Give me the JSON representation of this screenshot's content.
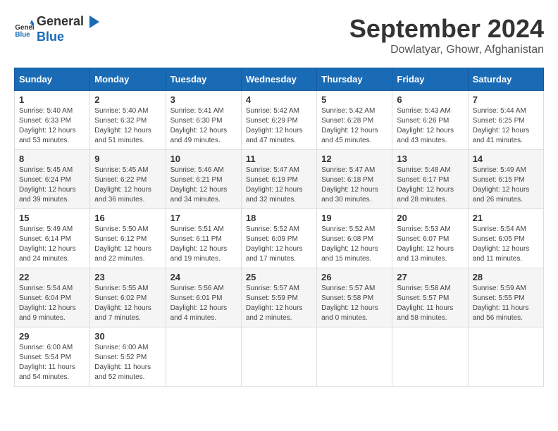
{
  "header": {
    "logo_general": "General",
    "logo_blue": "Blue",
    "month_year": "September 2024",
    "location": "Dowlatyar, Ghowr, Afghanistan"
  },
  "columns": [
    "Sunday",
    "Monday",
    "Tuesday",
    "Wednesday",
    "Thursday",
    "Friday",
    "Saturday"
  ],
  "weeks": [
    [
      {
        "day": "1",
        "sunrise": "5:40 AM",
        "sunset": "6:33 PM",
        "daylight": "12 hours and 53 minutes."
      },
      {
        "day": "2",
        "sunrise": "5:40 AM",
        "sunset": "6:32 PM",
        "daylight": "12 hours and 51 minutes."
      },
      {
        "day": "3",
        "sunrise": "5:41 AM",
        "sunset": "6:30 PM",
        "daylight": "12 hours and 49 minutes."
      },
      {
        "day": "4",
        "sunrise": "5:42 AM",
        "sunset": "6:29 PM",
        "daylight": "12 hours and 47 minutes."
      },
      {
        "day": "5",
        "sunrise": "5:42 AM",
        "sunset": "6:28 PM",
        "daylight": "12 hours and 45 minutes."
      },
      {
        "day": "6",
        "sunrise": "5:43 AM",
        "sunset": "6:26 PM",
        "daylight": "12 hours and 43 minutes."
      },
      {
        "day": "7",
        "sunrise": "5:44 AM",
        "sunset": "6:25 PM",
        "daylight": "12 hours and 41 minutes."
      }
    ],
    [
      {
        "day": "8",
        "sunrise": "5:45 AM",
        "sunset": "6:24 PM",
        "daylight": "12 hours and 39 minutes."
      },
      {
        "day": "9",
        "sunrise": "5:45 AM",
        "sunset": "6:22 PM",
        "daylight": "12 hours and 36 minutes."
      },
      {
        "day": "10",
        "sunrise": "5:46 AM",
        "sunset": "6:21 PM",
        "daylight": "12 hours and 34 minutes."
      },
      {
        "day": "11",
        "sunrise": "5:47 AM",
        "sunset": "6:19 PM",
        "daylight": "12 hours and 32 minutes."
      },
      {
        "day": "12",
        "sunrise": "5:47 AM",
        "sunset": "6:18 PM",
        "daylight": "12 hours and 30 minutes."
      },
      {
        "day": "13",
        "sunrise": "5:48 AM",
        "sunset": "6:17 PM",
        "daylight": "12 hours and 28 minutes."
      },
      {
        "day": "14",
        "sunrise": "5:49 AM",
        "sunset": "6:15 PM",
        "daylight": "12 hours and 26 minutes."
      }
    ],
    [
      {
        "day": "15",
        "sunrise": "5:49 AM",
        "sunset": "6:14 PM",
        "daylight": "12 hours and 24 minutes."
      },
      {
        "day": "16",
        "sunrise": "5:50 AM",
        "sunset": "6:12 PM",
        "daylight": "12 hours and 22 minutes."
      },
      {
        "day": "17",
        "sunrise": "5:51 AM",
        "sunset": "6:11 PM",
        "daylight": "12 hours and 19 minutes."
      },
      {
        "day": "18",
        "sunrise": "5:52 AM",
        "sunset": "6:09 PM",
        "daylight": "12 hours and 17 minutes."
      },
      {
        "day": "19",
        "sunrise": "5:52 AM",
        "sunset": "6:08 PM",
        "daylight": "12 hours and 15 minutes."
      },
      {
        "day": "20",
        "sunrise": "5:53 AM",
        "sunset": "6:07 PM",
        "daylight": "12 hours and 13 minutes."
      },
      {
        "day": "21",
        "sunrise": "5:54 AM",
        "sunset": "6:05 PM",
        "daylight": "12 hours and 11 minutes."
      }
    ],
    [
      {
        "day": "22",
        "sunrise": "5:54 AM",
        "sunset": "6:04 PM",
        "daylight": "12 hours and 9 minutes."
      },
      {
        "day": "23",
        "sunrise": "5:55 AM",
        "sunset": "6:02 PM",
        "daylight": "12 hours and 7 minutes."
      },
      {
        "day": "24",
        "sunrise": "5:56 AM",
        "sunset": "6:01 PM",
        "daylight": "12 hours and 4 minutes."
      },
      {
        "day": "25",
        "sunrise": "5:57 AM",
        "sunset": "5:59 PM",
        "daylight": "12 hours and 2 minutes."
      },
      {
        "day": "26",
        "sunrise": "5:57 AM",
        "sunset": "5:58 PM",
        "daylight": "12 hours and 0 minutes."
      },
      {
        "day": "27",
        "sunrise": "5:58 AM",
        "sunset": "5:57 PM",
        "daylight": "11 hours and 58 minutes."
      },
      {
        "day": "28",
        "sunrise": "5:59 AM",
        "sunset": "5:55 PM",
        "daylight": "11 hours and 56 minutes."
      }
    ],
    [
      {
        "day": "29",
        "sunrise": "6:00 AM",
        "sunset": "5:54 PM",
        "daylight": "11 hours and 54 minutes."
      },
      {
        "day": "30",
        "sunrise": "6:00 AM",
        "sunset": "5:52 PM",
        "daylight": "11 hours and 52 minutes."
      },
      null,
      null,
      null,
      null,
      null
    ]
  ]
}
